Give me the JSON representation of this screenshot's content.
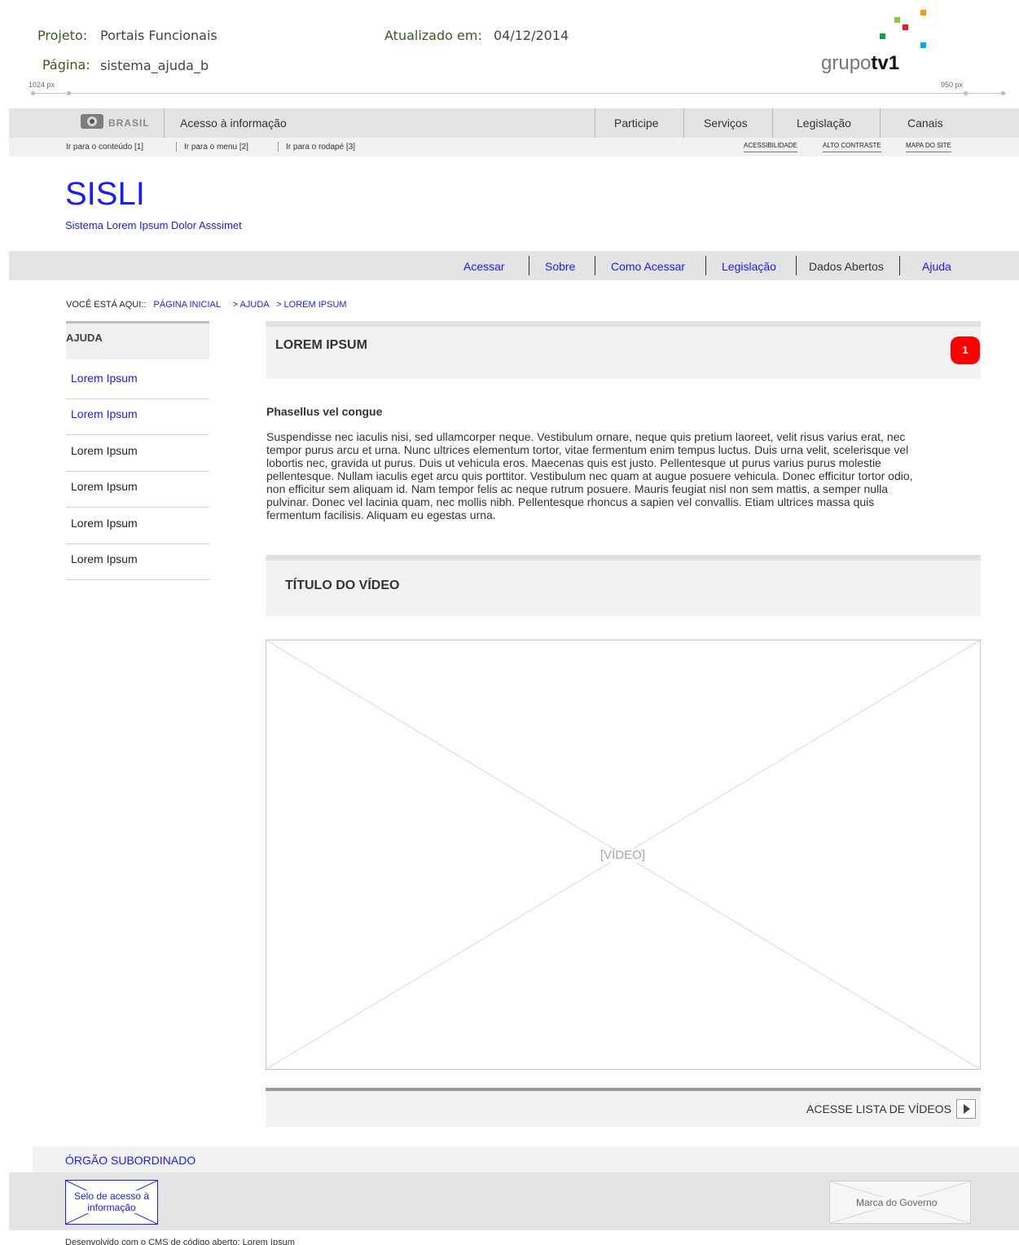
{
  "meta": {
    "project_label": "Projeto:",
    "project_value": "Portais Funcionais",
    "page_label": "Página:",
    "page_value": "sistema_ajuda_b",
    "updated_label": "Atualizado em:",
    "updated_value": "04/12/2014",
    "ruler_left": "1024 px",
    "ruler_right": "950 px"
  },
  "logo": {
    "text_light": "grupo",
    "text_bold": "tv1",
    "colors": [
      "#f7941d",
      "#8dc63f",
      "#ed1c24",
      "#00a651",
      "#00aeef"
    ]
  },
  "gov_bar": {
    "brasil_label": "BRASIL",
    "access_info": "Acesso à informação",
    "links": [
      "Participe",
      "Serviços",
      "Legislação",
      "Canais"
    ],
    "skip_links": [
      "Ir para o conteúdo [1]",
      "Ir para o menu [2]",
      "Ir para o rodapé [3]"
    ],
    "accessibility_links": [
      "ACESSIBILIDADE",
      "ALTO CONTRASTE",
      "MAPA DO SITE"
    ]
  },
  "site": {
    "title": "SISLI",
    "subtitle": "Sistema Lorem Ipsum Dolor Asssimet"
  },
  "main_nav": {
    "items": [
      "Acessar",
      "Sobre",
      "Como Acessar",
      "Legislação",
      "Dados Abertos",
      "Ajuda"
    ]
  },
  "breadcrumb": {
    "label": "VOCÊ ESTÁ AQUI::",
    "items": [
      "PÁGINA INICIAL",
      "> AJUDA",
      "> LOREM IPSUM"
    ]
  },
  "sidebar": {
    "heading": "AJUDA",
    "items": [
      "Lorem Ipsum",
      "Lorem Ipsum",
      "Lorem Ipsum",
      "Lorem Ipsum",
      "Lorem Ipsum",
      "Lorem Ipsum"
    ]
  },
  "content": {
    "title": "LOREM IPSUM",
    "badge": "1",
    "subtitle": "Phasellus vel congue",
    "lines": [
      "Suspendisse nec iaculis nisi, sed ullamcorper neque. Vestibulum ornare, neque quis pretium laoreet, velit risus varius erat, nec",
      "tempor purus arcu et urna. Nunc ultrices elementum tortor, vitae fermentum enim tempus luctus. Duis urna velit, scelerisque vel",
      "lobortis nec, gravida ut purus. Duis ut vehicula eros. Maecenas quis est justo. Pellentesque ut purus varius purus molestie",
      "pellentesque. Nullam iaculis eget arcu quis porttitor. Vestibulum nec quam at augue posuere vehicula. Donec efficitur tortor odio,",
      "non efficitur sem aliquam id. Nam tempor felis ac neque rutrum posuere. Mauris feugiat nisl non sem mattis, a semper nulla",
      "pulvinar. Donec vel lacinia quam, nec mollis nibh. Pellentesque rhoncus a sapien vel convallis. Etiam ultrices massa quis",
      "fermentum facilisis. Aliquam eu egestas urna."
    ],
    "video_title": "TÍTULO DO VÍDEO",
    "video_placeholder": "[VÍDEO]",
    "video_list_link": "ACESSE LISTA DE VÍDEOS"
  },
  "footer": {
    "org_label": "ÓRGÃO SUBORDINADO",
    "selo_line1": "Selo de acesso à",
    "selo_line2": "informação",
    "marca": "Marca do Governo",
    "developed": "Desenvolvido com o CMS de código aberto: Lorem Ipsum"
  },
  "colors": {
    "link_blue": "#1a1aff",
    "badge_red": "#ff0000",
    "bar_gray": "#e3e3e3",
    "panel_gray": "#f2f2f2"
  }
}
